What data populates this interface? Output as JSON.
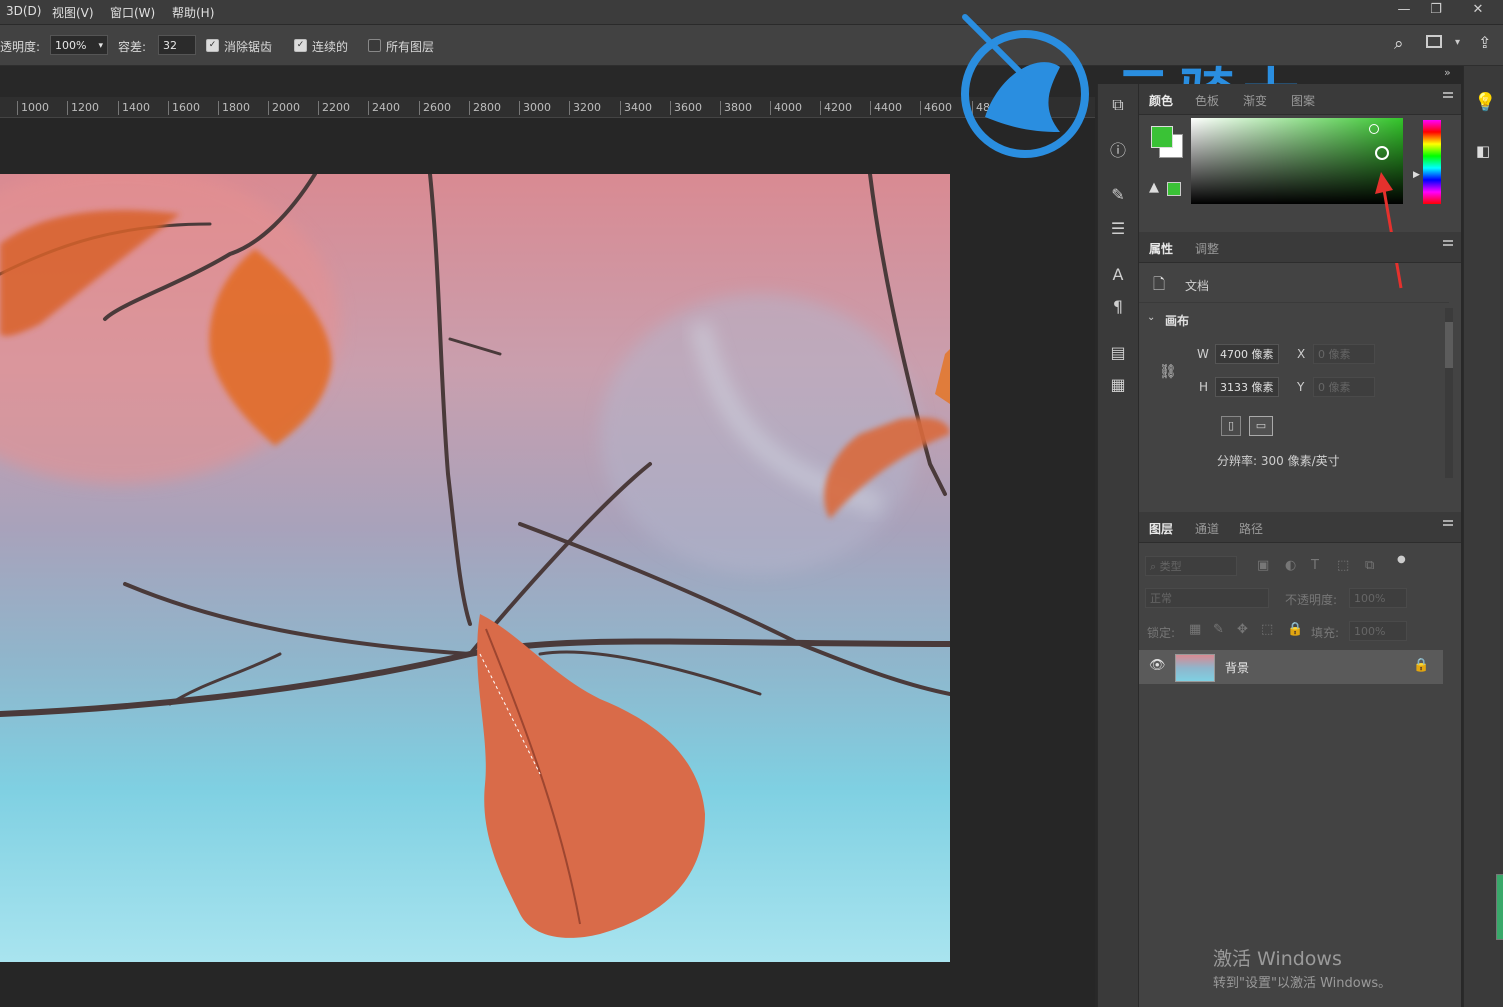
{
  "menubar": {
    "items": [
      "3D(D)",
      "视图(V)",
      "窗口(W)",
      "帮助(H)"
    ],
    "window_controls": [
      "minimize-icon",
      "restore-icon",
      "close-icon"
    ]
  },
  "options": {
    "opacity_label": "透明度:",
    "opacity_value": "100%",
    "tolerance_label": "容差:",
    "tolerance_value": "32",
    "antialias_label": "消除锯齿",
    "antialias_checked": true,
    "contiguous_label": "连续的",
    "contiguous_checked": true,
    "all_layers_label": "所有图层",
    "all_layers_checked": false,
    "expand_chevrons": "»"
  },
  "ruler": {
    "ticks": [
      "1000",
      "1200",
      "1400",
      "1600",
      "1800",
      "2000",
      "2200",
      "2400",
      "2600",
      "2800",
      "3000",
      "3200",
      "3400",
      "3600",
      "3800",
      "4000",
      "4200",
      "4400",
      "4600",
      "48"
    ]
  },
  "watermark": {
    "text": "云骑士"
  },
  "color_panel": {
    "tabs": [
      "颜色",
      "色板",
      "渐变",
      "图案"
    ],
    "foreground_color": "#3ac236",
    "background_color": "#ffffff",
    "field_hue_color": "#33c52a",
    "warning_swatch_color": "#3ac236"
  },
  "properties_panel": {
    "tabs": [
      "属性",
      "调整"
    ],
    "doc_label": "文档",
    "canvas_section": "画布",
    "w_label": "W",
    "w_value": "4700 像素",
    "h_label": "H",
    "h_value": "3133 像素",
    "x_label": "X",
    "x_value": "0 像素",
    "y_label": "Y",
    "y_value": "0 像素",
    "resolution": "分辨率: 300 像素/英寸"
  },
  "layers_panel": {
    "tabs": [
      "图层",
      "通道",
      "路径"
    ],
    "filter_placeholder": "类型",
    "blend_mode": "正常",
    "opacity_label": "不透明度:",
    "opacity_value": "100%",
    "lock_label": "锁定:",
    "fill_label": "填充:",
    "fill_value": "100%",
    "layers": [
      {
        "name": "背景",
        "visible": true,
        "locked": true
      }
    ]
  },
  "os_overlay": {
    "line1": "激活 Windows",
    "line2": "转到\"设置\"以激活 Windows。"
  }
}
